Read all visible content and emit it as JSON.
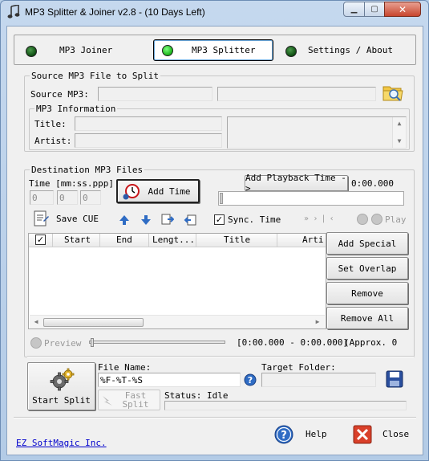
{
  "window": {
    "title": "MP3 Splitter & Joiner v2.8 - (10 Days Left)",
    "minimize_glyph": "▁",
    "maximize_glyph": "▢",
    "close_glyph": "✕"
  },
  "tabs": [
    {
      "label": "MP3 Joiner",
      "active": false
    },
    {
      "label": "MP3 Splitter",
      "active": true
    },
    {
      "label": "Settings / About",
      "active": false
    }
  ],
  "source": {
    "group_title": "Source MP3 File to Split",
    "source_label": "Source MP3:",
    "source_value": "",
    "source_value2": ""
  },
  "mp3_info": {
    "group_title": "MP3 Information",
    "title_label": "Title:",
    "title_value": "",
    "artist_label": "Artist:",
    "artist_value": ""
  },
  "destination": {
    "group_title": "Destination MP3 Files",
    "time_label": "Time [mm:ss.ppp]",
    "time_min": "0",
    "time_sec": "0",
    "time_ms": "0",
    "add_time_label": "Add Time",
    "add_playback_label": "Add Playback Time ->",
    "playback_time": "0:00.000",
    "save_cue_label": "Save CUE",
    "sync_time_label": "Sync. Time",
    "sync_time_checked": true,
    "play_label": "Play"
  },
  "table": {
    "columns": [
      "",
      "Start",
      "End",
      "Lengt...",
      "Title",
      "Arti"
    ],
    "rows": []
  },
  "side_buttons": {
    "add_special": "Add Special",
    "set_overlap": "Set Overlap",
    "remove": "Remove",
    "remove_all": "Remove All"
  },
  "preview": {
    "preview_label": "Preview",
    "range_text": "[0:00.000 - 0:00.000]",
    "approx_text": "(Approx. 0"
  },
  "output": {
    "start_split_label": "Start Split",
    "file_name_label": "File Name:",
    "file_name_value": "%F-%T-%S",
    "target_folder_label": "Target Folder:",
    "target_folder_value": "",
    "fast_split_label_1": "Fast",
    "fast_split_label_2": "Split",
    "status_label": "Status: Idle"
  },
  "footer": {
    "company_link": "EZ SoftMagic Inc.",
    "help_label": "Help",
    "close_label": "Close"
  },
  "colors": {
    "accent_blue": "#1f5fb4",
    "close_red": "#d9402a",
    "led_green": "#1ab31a"
  }
}
